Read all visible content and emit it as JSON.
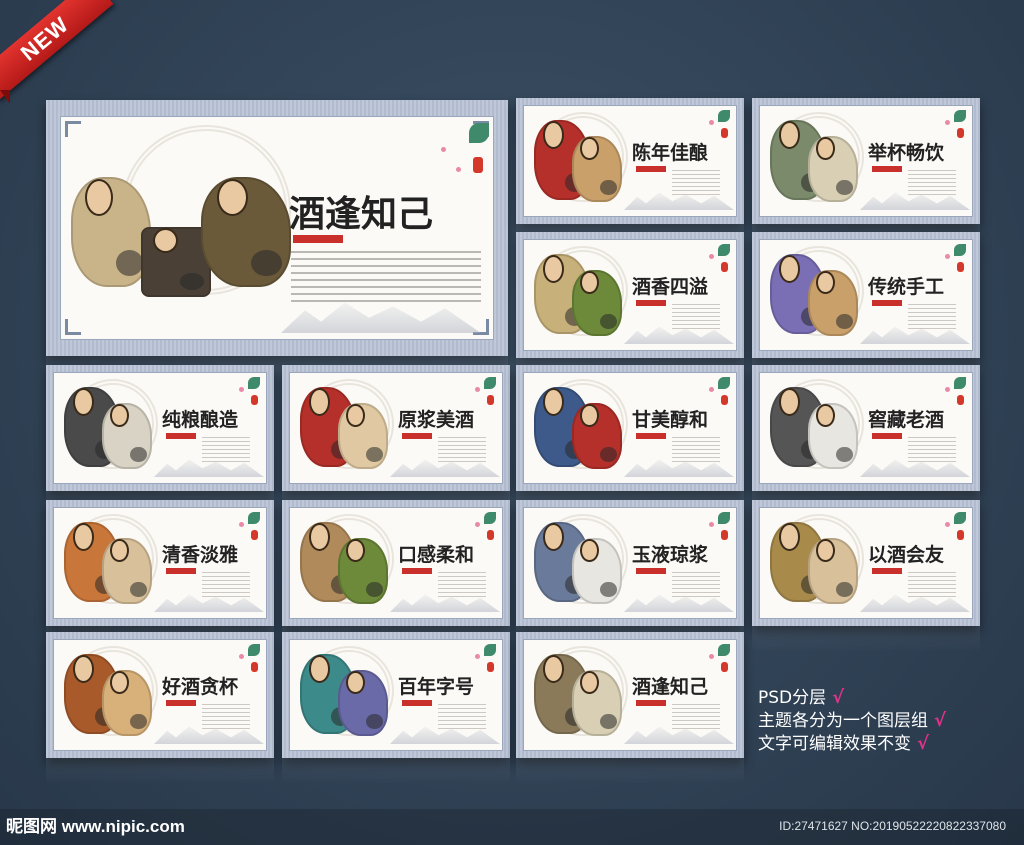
{
  "badge": "NEW",
  "main_board": {
    "title": "酒逢知己"
  },
  "boards": [
    {
      "title": "陈年佳酿",
      "palette": [
        "#b5302a",
        "#c9a06a"
      ]
    },
    {
      "title": "举杯畅饮",
      "palette": [
        "#7a8a6a",
        "#d8cfb4"
      ]
    },
    {
      "title": "酒香四溢",
      "palette": [
        "#c8b07a",
        "#6d8a3a"
      ]
    },
    {
      "title": "传统手工",
      "palette": [
        "#7a6fb4",
        "#c9a06a"
      ]
    },
    {
      "title": "纯粮酿造",
      "palette": [
        "#4a4a4a",
        "#d8d3c4"
      ]
    },
    {
      "title": "原浆美酒",
      "palette": [
        "#b5302a",
        "#e0c9a2"
      ]
    },
    {
      "title": "甘美醇和",
      "palette": [
        "#3d5a8a",
        "#b5302a"
      ]
    },
    {
      "title": "窖藏老酒",
      "palette": [
        "#555555",
        "#e8e6e0"
      ]
    },
    {
      "title": "清香淡雅",
      "palette": [
        "#c9763a",
        "#d8c09a"
      ]
    },
    {
      "title": "口感柔和",
      "palette": [
        "#b08a5a",
        "#6d8a3a"
      ]
    },
    {
      "title": "玉液琼浆",
      "palette": [
        "#6a7a9a",
        "#e8e6e0"
      ]
    },
    {
      "title": "以酒会友",
      "palette": [
        "#a88a4a",
        "#d8c09a"
      ]
    },
    {
      "title": "好酒贪杯",
      "palette": [
        "#a85a2a",
        "#d8b07a"
      ]
    },
    {
      "title": "百年字号",
      "palette": [
        "#3d8a8a",
        "#6a6aa8"
      ]
    },
    {
      "title": "酒逢知己",
      "palette": [
        "#8a7a5a",
        "#d8cfb4"
      ]
    }
  ],
  "features": [
    {
      "text": "PSD分层",
      "check": "√"
    },
    {
      "text": "主题各分为一个图层组",
      "check": "√"
    },
    {
      "text": "文字可编辑效果不变",
      "check": "√"
    }
  ],
  "footer": {
    "site": "昵图网 www.nipic.com",
    "id_text": "ID:27471627 NO:20190522220822337080"
  },
  "colors": {
    "background": "#34465a",
    "frame": "#b9c3d6",
    "accent_check": "#e0328a",
    "ribbon": "#d0282a"
  }
}
